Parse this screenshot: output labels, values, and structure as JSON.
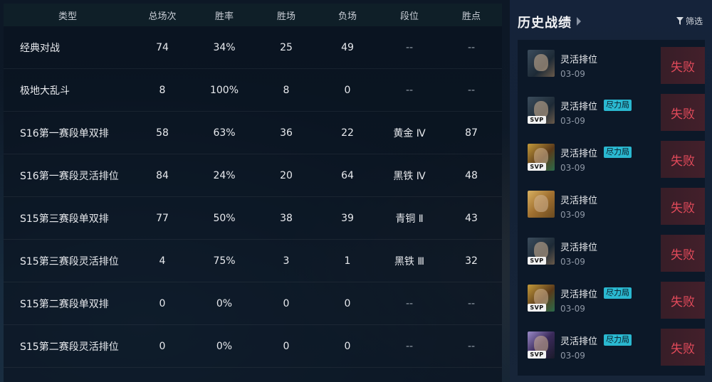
{
  "table": {
    "headers": [
      "类型",
      "总场次",
      "胜率",
      "胜场",
      "负场",
      "段位",
      "胜点"
    ],
    "rows": [
      [
        "经典对战",
        "74",
        "34%",
        "25",
        "49",
        "--",
        "--"
      ],
      [
        "极地大乱斗",
        "8",
        "100%",
        "8",
        "0",
        "--",
        "--"
      ],
      [
        "S16第一赛段单双排",
        "58",
        "63%",
        "36",
        "22",
        "黄金 Ⅳ",
        "87"
      ],
      [
        "S16第一赛段灵活排位",
        "84",
        "24%",
        "20",
        "64",
        "黑铁 Ⅳ",
        "48"
      ],
      [
        "S15第三赛段单双排",
        "77",
        "50%",
        "38",
        "39",
        "青铜 Ⅱ",
        "43"
      ],
      [
        "S15第三赛段灵活排位",
        "4",
        "75%",
        "3",
        "1",
        "黑铁 Ⅲ",
        "32"
      ],
      [
        "S15第二赛段单双排",
        "0",
        "0%",
        "0",
        "0",
        "--",
        "--"
      ],
      [
        "S15第二赛段灵活排位",
        "0",
        "0%",
        "0",
        "0",
        "--",
        "--"
      ]
    ]
  },
  "history": {
    "title": "历史战绩",
    "filter_label": "筛选",
    "filter_icon": "funnel-icon",
    "matches": [
      {
        "mode": "灵活排位",
        "tag": "",
        "date": "03-09",
        "result": "失败",
        "svp": "",
        "avatar": "a1"
      },
      {
        "mode": "灵活排位",
        "tag": "尽力局",
        "date": "03-09",
        "result": "失败",
        "svp": "SVP",
        "avatar": "a1"
      },
      {
        "mode": "灵活排位",
        "tag": "尽力局",
        "date": "03-09",
        "result": "失败",
        "svp": "SVP",
        "avatar": "a2"
      },
      {
        "mode": "灵活排位",
        "tag": "",
        "date": "03-09",
        "result": "失败",
        "svp": "",
        "avatar": "a3"
      },
      {
        "mode": "灵活排位",
        "tag": "",
        "date": "03-09",
        "result": "失败",
        "svp": "SVP",
        "avatar": "a1"
      },
      {
        "mode": "灵活排位",
        "tag": "尽力局",
        "date": "03-09",
        "result": "失败",
        "svp": "SVP",
        "avatar": "a2"
      },
      {
        "mode": "灵活排位",
        "tag": "尽力局",
        "date": "03-09",
        "result": "失败",
        "svp": "SVP",
        "avatar": "a4"
      }
    ]
  },
  "colors": {
    "loss_text": "#e24a5a",
    "tag_bg": "#2ab8d0",
    "panel_bg": "#0c1828"
  }
}
